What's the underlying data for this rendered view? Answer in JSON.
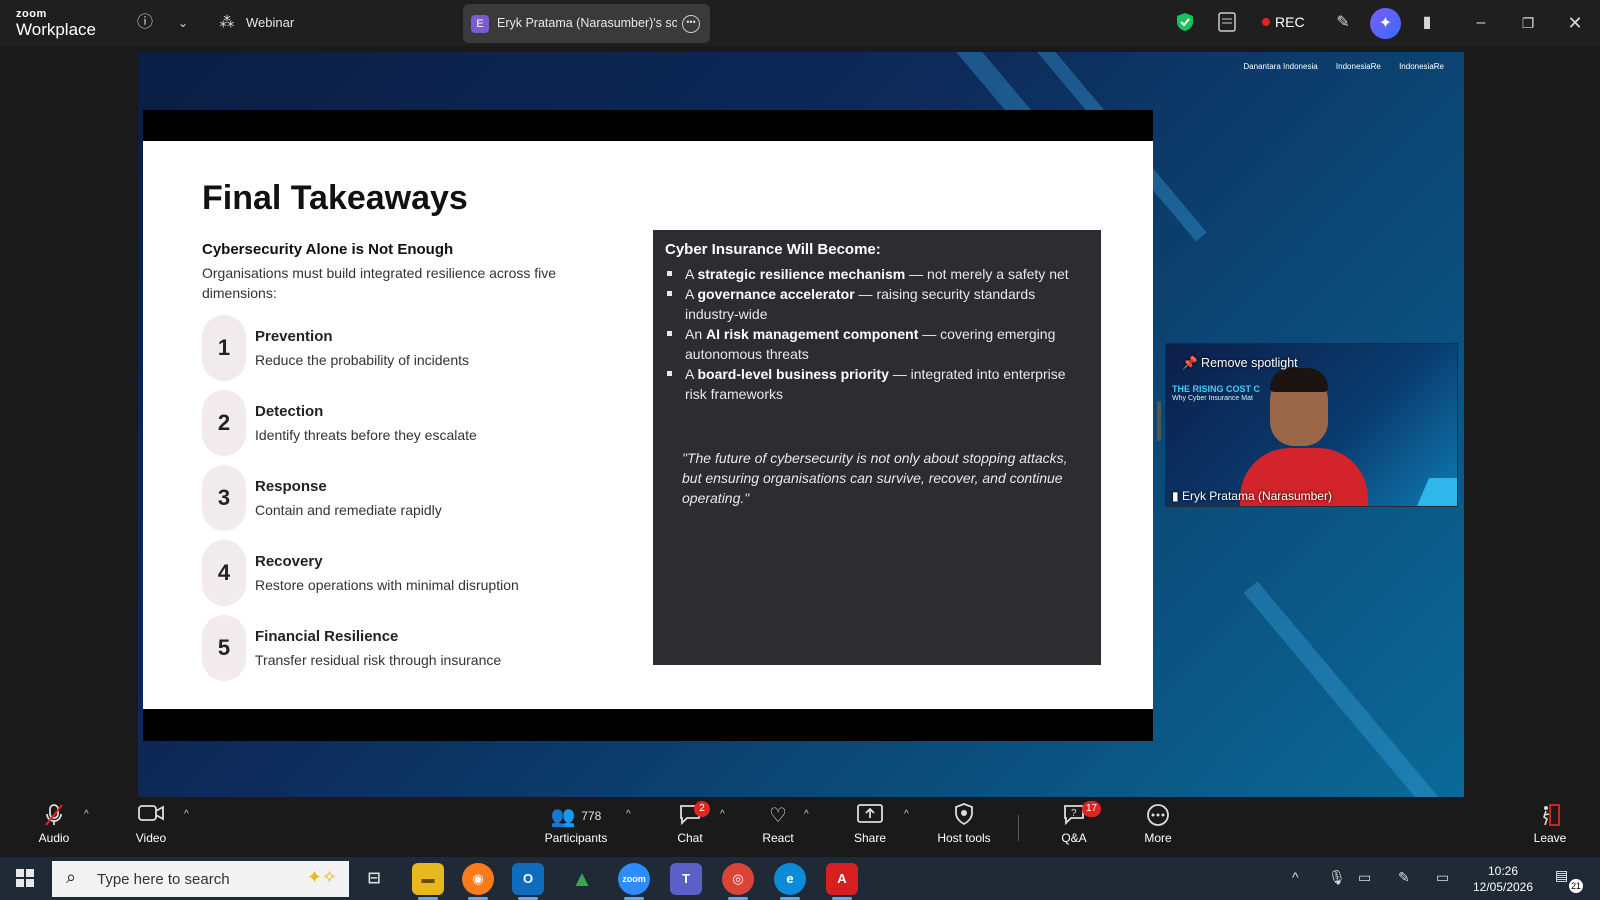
{
  "window": {
    "app_brand_top": "zoom",
    "app_brand_bottom": "Workplace",
    "meeting_type": "Webinar",
    "share_tab_avatar": "E",
    "share_tab_label": "Eryk Pratama (Narasumber)'s scre",
    "rec_label": "REC"
  },
  "slide": {
    "title": "Final Takeaways",
    "subtitle": "Cybersecurity Alone is Not Enough",
    "description": "Organisations must build integrated resilience across five dimensions:",
    "steps": [
      {
        "num": "1",
        "title": "Prevention",
        "desc": "Reduce the probability of incidents"
      },
      {
        "num": "2",
        "title": "Detection",
        "desc": "Identify threats before they escalate"
      },
      {
        "num": "3",
        "title": "Response",
        "desc": "Contain and remediate rapidly"
      },
      {
        "num": "4",
        "title": "Recovery",
        "desc": "Restore operations with minimal disruption"
      },
      {
        "num": "5",
        "title": "Financial Resilience",
        "desc": "Transfer residual risk through insurance"
      }
    ],
    "box_heading": "Cyber Insurance Will Become:",
    "bullets": [
      {
        "pre": "A ",
        "bold": "strategic resilience mechanism",
        "post": " — not merely a safety net"
      },
      {
        "pre": "A ",
        "bold": "governance accelerator",
        "post": " — raising security standards industry-wide"
      },
      {
        "pre": "An ",
        "bold": "AI risk management component",
        "post": " — covering emerging autonomous threats"
      },
      {
        "pre": "A ",
        "bold": "board-level business priority",
        "post": " — integrated into enterprise risk frameworks"
      }
    ],
    "quote": "\"The future of cybersecurity is not only about stopping attacks, but ensuring organisations can survive, recover, and continue operating.\"",
    "logos": [
      "Danantara Indonesia",
      "IndonesiaRe",
      "IndonesiaRe"
    ]
  },
  "video_tile": {
    "remove_spotlight": "Remove spotlight",
    "speaker_name": "Eryk Pratama (Narasumber)",
    "bg_title": "THE RISING COST C",
    "bg_sub": "Why Cyber Insurance Mat"
  },
  "toolbar": {
    "audio": "Audio",
    "video": "Video",
    "participants": "Participants",
    "participants_count": "778",
    "chat": "Chat",
    "chat_badge": "2",
    "react": "React",
    "share": "Share",
    "host_tools": "Host tools",
    "qa": "Q&A",
    "qa_badge": "17",
    "more": "More",
    "leave": "Leave"
  },
  "taskbar": {
    "search_placeholder": "Type here to search",
    "time": "10:26",
    "date": "12/05/2026",
    "notification_count": "21"
  },
  "colors": {
    "accent_red": "#e02424",
    "slide_bg": "#ffffff",
    "box_bg": "#2d2c30",
    "share_bg": "#0d2a5a"
  }
}
